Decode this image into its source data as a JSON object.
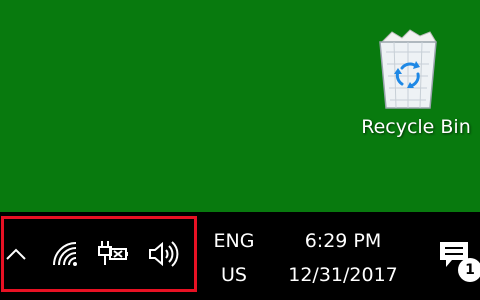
{
  "desktop": {
    "background_color": "#087a0e",
    "recycle_bin": {
      "label": "Recycle Bin",
      "icon": "recycle-bin-icon"
    }
  },
  "taskbar": {
    "background_color": "#000000",
    "tray": {
      "highlight_color": "#e81123",
      "icons": [
        "chevron-up-icon",
        "wifi-icon",
        "battery-plug-icon",
        "speaker-icon"
      ]
    },
    "language": {
      "line1": "ENG",
      "line2": "US"
    },
    "clock": {
      "time": "6:29 PM",
      "date": "12/31/2017"
    },
    "action_center": {
      "icon": "notifications-icon",
      "badge_count": "1"
    }
  }
}
